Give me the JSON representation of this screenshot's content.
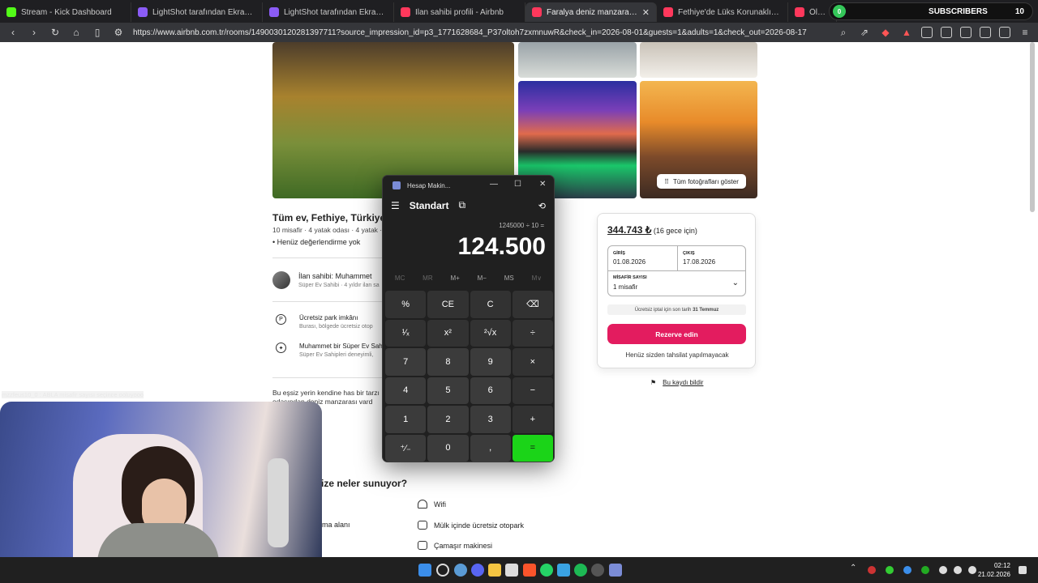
{
  "browser": {
    "tabs": [
      {
        "label": "Stream - Kick Dashboard",
        "color": "#53fc18"
      },
      {
        "label": "LightShot tarafından Ekran Görüntüs",
        "color": "#8b5cf6"
      },
      {
        "label": "LightShot tarafından Ekran Görüntüs",
        "color": "#8b5cf6"
      },
      {
        "label": "İlan sahibi profili - Airbnb",
        "color": "#ff385c"
      },
      {
        "label": "Faralya deniz manzaralı villa - Fe",
        "color": "#ff385c",
        "active": true
      },
      {
        "label": "Fethiye'de Lüks Korunaklı Villa – Öze",
        "color": "#ff385c"
      },
      {
        "label": "Ölüdeniz Kumburnu'nde Sessiz Ko",
        "color": "#ff385c"
      }
    ],
    "url": "https://www.airbnb.com.tr/rooms/1490030120281397711?source_impression_id=p3_1771628684_P37oltoh7zxmnuwR&check_in=2026-08-01&guests=1&adults=1&check_out=2026-08-17"
  },
  "overlay": {
    "subscribers_label": "SUBSCRIBERS",
    "subscribers_count": "10",
    "goal_current": "0",
    "chat_line": "mzzfeus10_0 : ABLA misafir sayısı seçince ooluyooo"
  },
  "listing": {
    "show_all_photos": "Tüm fotoğrafları göster",
    "title": "Tüm ev, Fethiye, Türkiye",
    "capacity": "10 misafir · 4 yatak odası · 4 yatak ·",
    "rating": "• Henüz değerlendirme yok",
    "host_name": "İlan sahibi: Muhammet",
    "host_sub": "Süper Ev Sahibi · 4 yıldır ilan sa",
    "features": [
      {
        "title": "Ücretsiz park imkânı",
        "sub": "Burası, bölgede ücretsiz otop"
      },
      {
        "title": "Muhammet bir Süper Ev Sahi",
        "sub": "Süper Ev Sahipleri deneyimli,"
      }
    ],
    "description": "Bu eşsiz yerin kendine has bir tarzı odasından deniz manzarası vard",
    "offers_title": "ize neler sunuyor?",
    "amenities": [
      {
        "label": "Wifi"
      },
      {
        "label": "Mülk içinde ücretsiz otopark"
      },
      {
        "label": "Çamaşır makinesi"
      },
      {
        "label": "ma alanı"
      }
    ],
    "report": "Bu kaydı bildir"
  },
  "booking": {
    "price": "344.743 ₺",
    "price_note": "(16 gece için)",
    "checkin_label": "GİRİŞ",
    "checkin": "01.08.2026",
    "checkout_label": "ÇIKIŞ",
    "checkout": "17.08.2026",
    "guests_label": "MİSAFİR SAYISI",
    "guests": "1 misafir",
    "cancel_prefix": "Ücretsiz iptal için son tarih",
    "cancel_date": "31 Temmuz",
    "reserve": "Rezerve edin",
    "no_charge": "Henüz sizden tahsilat yapılmayacak"
  },
  "calculator": {
    "window_title": "Hesap Makin...",
    "mode": "Standart",
    "expression": "1245000 ÷ 10 =",
    "display": "124.500",
    "memory": [
      "MC",
      "MR",
      "M+",
      "M−",
      "MS",
      "M∨"
    ],
    "keys": [
      "%",
      "CE",
      "C",
      "⌫",
      "¹⁄ₓ",
      "x²",
      "²√x",
      "÷",
      "7",
      "8",
      "9",
      "×",
      "4",
      "5",
      "6",
      "−",
      "1",
      "2",
      "3",
      "+",
      "⁺⁄₋",
      "0",
      ",",
      "="
    ]
  },
  "taskbar": {
    "time": "02:12",
    "date": "21.02.2026"
  }
}
